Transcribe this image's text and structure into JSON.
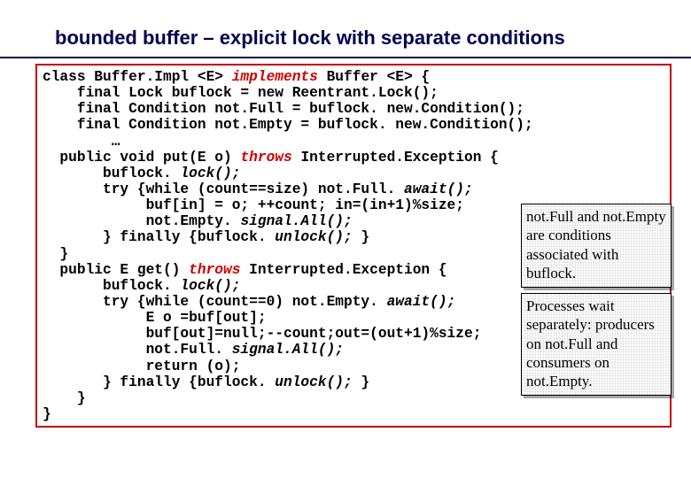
{
  "title": "bounded buffer – explicit lock with separate conditions",
  "code": {
    "line1a": "class Buffer.Impl <E> ",
    "line1b": "implements",
    "line1c": " Buffer <E> {",
    "line2": "    final Lock buflock = new Reentrant.Lock();",
    "line3": "    final Condition not.Full = buflock. new.Condition();",
    "line4": "    final Condition not.Empty = buflock. new.Condition();",
    "line5": "        …",
    "line6a": "  public void put(E o) ",
    "line6b": "throws",
    "line6c": " Interrupted.Exception {",
    "line7a": "       buflock. ",
    "line7b": "lock();",
    "line8a": "       try {while (count==size) not.Full. ",
    "line8b": "await();",
    "line9": "            buf[in] = o; ++count; in=(in+1)%size;",
    "line10a": "            not.Empty. ",
    "line10b": "signal.All();",
    "line11a": "       } finally {buflock. ",
    "line11b": "unlock();",
    "line11c": " }",
    "line12": "  }",
    "line13a": "  public E get() ",
    "line13b": "throws",
    "line13c": " Interrupted.Exception {",
    "line14a": "       buflock. ",
    "line14b": "lock();",
    "line15a": "       try {while (count==0) not.Empty. ",
    "line15b": "await();",
    "line16": "            E o =buf[out];",
    "line17": "            buf[out]=null;--count;out=(out+1)%size;",
    "line18a": "            not.Full. ",
    "line18b": "signal.All();",
    "line19": "            return (o);",
    "line20a": "       } finally {buflock. ",
    "line20b": "unlock();",
    "line20c": " }",
    "line21": "    }",
    "line22": "}"
  },
  "annot": {
    "box1": "not.Full and not.Empty are conditions associated with buflock.",
    "box2": "Processes wait separately: producers on not.Full and consumers on not.Empty."
  }
}
